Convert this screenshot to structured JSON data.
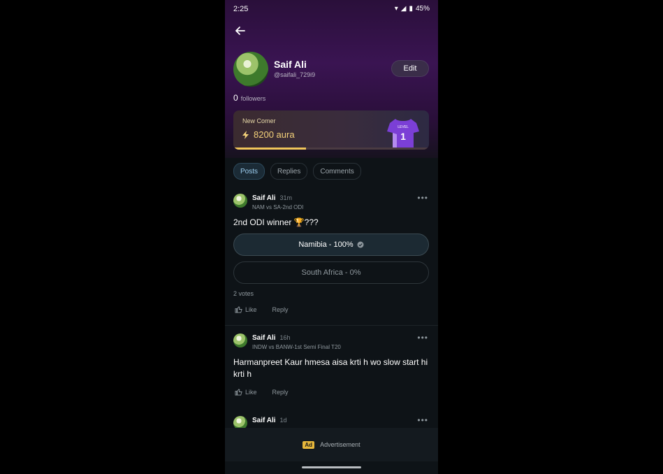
{
  "status": {
    "time": "2:25",
    "battery": "45%"
  },
  "profile": {
    "name": "Saif Ali",
    "handle": "@saifali_729i9",
    "edit_label": "Edit",
    "followers_count": "0",
    "followers_label": "followers"
  },
  "aura": {
    "level_title": "New Comer",
    "value": "8200 aura",
    "progress": 0.37,
    "jersey_level_label": "LEVEL",
    "jersey_number": "1"
  },
  "tabs": [
    {
      "label": "Posts",
      "active": true
    },
    {
      "label": "Replies",
      "active": false
    },
    {
      "label": "Comments",
      "active": false
    }
  ],
  "posts": [
    {
      "author": "Saif Ali",
      "time": "31m",
      "match": "NAM vs SA-2nd ODI",
      "text": "2nd ODI winner 🏆???",
      "poll": [
        {
          "label": "Namibia - 100%",
          "winner": true
        },
        {
          "label": "South Africa - 0%",
          "winner": false
        }
      ],
      "votes": "2 votes",
      "like_label": "Like",
      "reply_label": "Reply"
    },
    {
      "author": "Saif Ali",
      "time": "16h",
      "match": "INDW vs BANW-1st Semi Final T20",
      "text": "Harmanpreet Kaur hmesa aisa krti h wo slow start hi krti h",
      "like_label": "Like",
      "reply_label": "Reply"
    },
    {
      "author": "Saif Ali",
      "time": "1d"
    }
  ],
  "ad": {
    "badge": "Ad",
    "label": "Advertisement"
  },
  "colors": {
    "accent": "#f0c65a",
    "tab_active": "#9fd1f3",
    "header": "#3a1452"
  }
}
